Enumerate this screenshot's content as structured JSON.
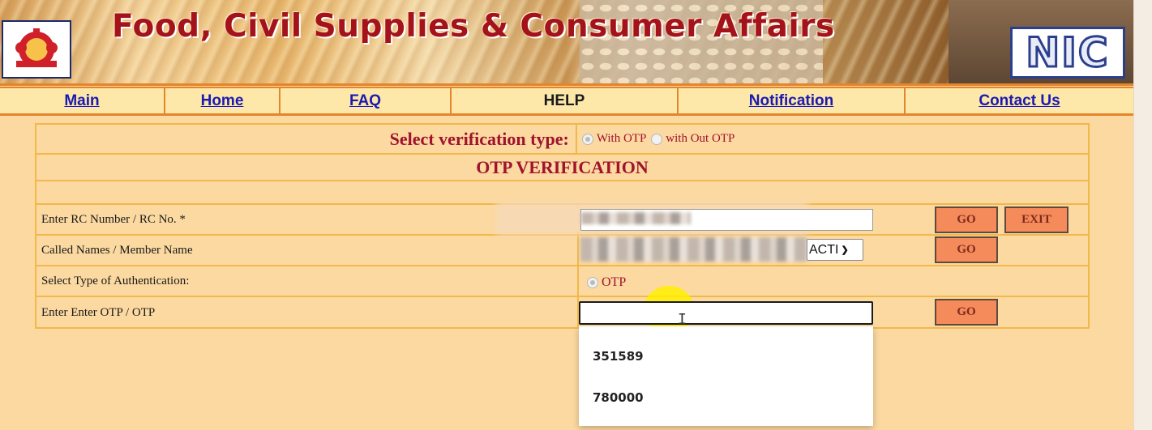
{
  "banner": {
    "title": "Food, Civil Supplies & Consumer Affairs",
    "logo_text": "NIC"
  },
  "nav": [
    {
      "label": "Main",
      "link": true
    },
    {
      "label": "Home",
      "link": true
    },
    {
      "label": "FAQ",
      "link": true
    },
    {
      "label": "HELP",
      "link": false
    },
    {
      "label": "Notification",
      "link": true
    },
    {
      "label": "Contact Us",
      "link": true
    }
  ],
  "verification": {
    "label": "Select verification type:",
    "options": [
      "With OTP",
      "with Out OTP"
    ],
    "selected": "With OTP"
  },
  "section_title": "OTP VERIFICATION",
  "fields": {
    "rc_label": "Enter RC Number / RC No. *",
    "member_label": "Called Names / Member Name",
    "member_select_value": "ACTI",
    "auth_label": "Select Type of Authentication:",
    "auth_option": "OTP",
    "otp_label": "Enter Enter OTP / OTP",
    "otp_value": ""
  },
  "buttons": {
    "go": "GO",
    "exit": "EXIT"
  },
  "autocomplete": [
    "351589",
    "780000"
  ],
  "icons": {
    "emblem": "state-emblem-icon",
    "cursor": "text-cursor-icon",
    "chevron": "chevron-down-icon"
  },
  "colors": {
    "background": "#fcd9a0",
    "accent": "#a0122d",
    "link": "#1a1ab3",
    "button": "#f58a5a",
    "border": "#f1b84a"
  }
}
